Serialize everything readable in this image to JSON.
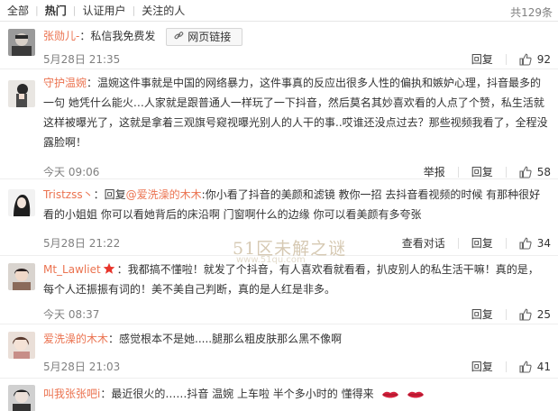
{
  "filter_bar": {
    "tabs": [
      {
        "label": "全部"
      },
      {
        "label": "热门"
      },
      {
        "label": "认证用户"
      },
      {
        "label": "关注的人"
      }
    ],
    "total": "共129条"
  },
  "watermark": {
    "text": "51区未解之谜",
    "sub": "www.51qu.com"
  },
  "comments": [
    {
      "user": "张勋儿-",
      "sep": "：",
      "text": "私信我免费发",
      "link_label": "网页链接",
      "time": "5月28日 21:35",
      "reply_label": "回复",
      "likes": "92"
    },
    {
      "user": "守护温婉",
      "sep": "：",
      "text": "温婉这件事就是中国的网络暴力，这件事真的反应出很多人性的偏执和嫉妒心理，抖音最多的一句 她凭什么能火…人家就是跟普通人一样玩了一下抖音，然后莫名其妙喜欢看的人点了个赞，私生活就这样被曝光了，这就是拿着三观旗号窥视曝光别人的人干的事..哎谁还没点过去？那些视频我看了，全程没露脸啊！",
      "time": "今天 09:06",
      "report_label": "举报",
      "reply_label": "回复",
      "likes": "58"
    },
    {
      "user": "Tristzss丶",
      "sep": "：",
      "text_prefix": "回复",
      "mention": "@爱洗澡的木木",
      "text": ":你小看了抖音的美颜和滤镜 教你一招 去抖音看视频的时候 有那种很好看的小姐姐 你可以看她背后的床沿啊 门窗啊什么的边缘 你可以看美颜有多夸张",
      "time": "5月28日 21:22",
      "view_conversation_label": "查看对话",
      "reply_label": "回复",
      "likes": "34"
    },
    {
      "user": "Mt_Lawliet",
      "sep": "：",
      "text": "我都搞不懂啦！就发了个抖音，有人喜欢看就看看，扒皮别人的私生活干嘛！真的是，每个人还振振有词的！美不美自己判断，真的是人红是非多。",
      "time": "今天 08:37",
      "reply_label": "回复",
      "likes": "25"
    },
    {
      "user": "爱洗澡的木木",
      "sep": "：",
      "text": "感觉根本不是她.....腿那么粗皮肤那么黑不像啊",
      "time": "5月28日 21:03",
      "reply_label": "回复",
      "likes": "41"
    },
    {
      "user": "叫我张张吧i",
      "sep": "：",
      "text": "最近很火的……抖音 温婉 上车啦 半个多小时的 懂得来"
    }
  ],
  "colors": {
    "username": "#eb7350",
    "time": "#808080",
    "medal": "#e8352b"
  }
}
